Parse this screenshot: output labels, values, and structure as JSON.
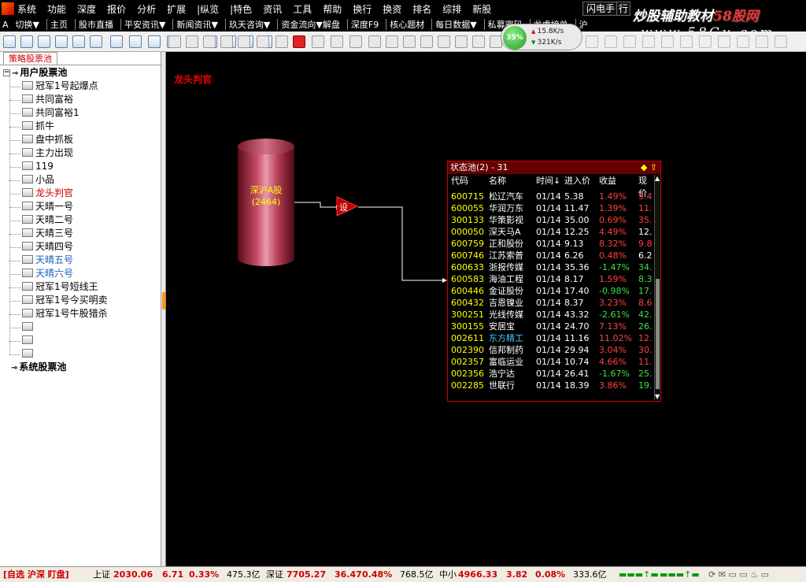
{
  "menubar": {
    "items": [
      "系统",
      "功能",
      "深度",
      "报价",
      "分析",
      "扩展",
      "|纵览",
      "|特色",
      "资讯",
      "工具",
      "帮助",
      "换行",
      "换资",
      "排名",
      "综排",
      "新股"
    ],
    "flash": "闪电手",
    "flash2": "行"
  },
  "watermark": {
    "line1": "炒股辅助教材",
    "line1_red": "58股网",
    "line2": "www.58Gu.com"
  },
  "bar2": {
    "items": [
      "切换▼",
      "主页",
      "股市直播",
      "平安资讯▼",
      "新闻资讯▼",
      "玖天咨询▼",
      "资金流向▼解盘",
      "深度F9",
      "核心题材",
      "每日数据▼",
      "私募密码",
      "龙虎榜单",
      "沪"
    ]
  },
  "netgauge": {
    "percent": "35%",
    "up": "15.8K/s",
    "down": "321K/s"
  },
  "left": {
    "tab": "策略股票池",
    "tree": [
      {
        "label": "用户股票池",
        "kind": "root"
      },
      {
        "label": "冠军1号起爆点",
        "kind": "leaf"
      },
      {
        "label": "共同富裕",
        "kind": "leaf"
      },
      {
        "label": "共同富裕1",
        "kind": "leaf"
      },
      {
        "label": "抓牛",
        "kind": "leaf"
      },
      {
        "label": "盘中抓板",
        "kind": "leaf"
      },
      {
        "label": "主力出现",
        "kind": "leaf"
      },
      {
        "label": "119",
        "kind": "leaf"
      },
      {
        "label": "小品",
        "kind": "leaf"
      },
      {
        "label": "龙头判官",
        "kind": "sel"
      },
      {
        "label": "天晴一号",
        "kind": "leaf"
      },
      {
        "label": "天晴二号",
        "kind": "leaf"
      },
      {
        "label": "天晴三号",
        "kind": "leaf"
      },
      {
        "label": "天晴四号",
        "kind": "leaf"
      },
      {
        "label": "天晴五号",
        "kind": "blue"
      },
      {
        "label": "天晴六号",
        "kind": "blue"
      },
      {
        "label": "冠军1号短线王",
        "kind": "leaf"
      },
      {
        "label": "冠军1号今买明卖",
        "kind": "leaf"
      },
      {
        "label": "冠军1号牛股猎杀",
        "kind": "leaf"
      },
      {
        "label": "",
        "kind": "leaf"
      },
      {
        "label": "",
        "kind": "leaf"
      },
      {
        "label": "",
        "kind": "leaf"
      },
      {
        "label": "系统股票池",
        "kind": "root2"
      }
    ]
  },
  "canvas": {
    "title": "龙头判官",
    "source_label": "深沪A股",
    "source_count": "(2464)",
    "setting_label": "设"
  },
  "pool": {
    "title": "状态池(2) - 31",
    "columns": [
      "代码",
      "名称",
      "时间↓",
      "进入价",
      "收益",
      "现价"
    ],
    "colors": {
      "up": "#ff4040",
      "down": "#40e040",
      "cur_up": "#ff4040",
      "cur_down": "#40e040",
      "highlight": "#40c8ff"
    },
    "rows": [
      {
        "code": "600715",
        "name": "松辽汽车",
        "time": "01/14",
        "price": "5.38",
        "gain": "1.49%",
        "cur": "5.4",
        "dir": "up"
      },
      {
        "code": "600055",
        "name": "华润万东",
        "time": "01/14",
        "price": "11.47",
        "gain": "1.39%",
        "cur": "11.",
        "dir": "up"
      },
      {
        "code": "300133",
        "name": "华策影视",
        "time": "01/14",
        "price": "35.00",
        "gain": "0.69%",
        "cur": "35.",
        "dir": "up"
      },
      {
        "code": "000050",
        "name": "深天马A",
        "time": "01/14",
        "price": "12.25",
        "gain": "4.49%",
        "cur": "12.",
        "dir": "up",
        "cur_white": true
      },
      {
        "code": "600759",
        "name": "正和股份",
        "time": "01/14",
        "price": "9.13",
        "gain": "8.32%",
        "cur": "9.8",
        "dir": "up"
      },
      {
        "code": "600746",
        "name": "江苏索普",
        "time": "01/14",
        "price": "6.26",
        "gain": "0.48%",
        "cur": "6.2",
        "dir": "up",
        "cur_white": true
      },
      {
        "code": "600633",
        "name": "浙报传媒",
        "time": "01/14",
        "price": "35.36",
        "gain": "-1.47%",
        "cur": "34.",
        "dir": "down"
      },
      {
        "code": "600583",
        "name": "海油工程",
        "time": "01/14",
        "price": "8.17",
        "gain": "1.59%",
        "cur": "8.3",
        "dir": "up",
        "cur_green": true
      },
      {
        "code": "600446",
        "name": "金证股份",
        "time": "01/14",
        "price": "17.40",
        "gain": "-0.98%",
        "cur": "17.",
        "dir": "down"
      },
      {
        "code": "600432",
        "name": "吉恩镍业",
        "time": "01/14",
        "price": "8.37",
        "gain": "3.23%",
        "cur": "8.6",
        "dir": "up"
      },
      {
        "code": "300251",
        "name": "光线传媒",
        "time": "01/14",
        "price": "43.32",
        "gain": "-2.61%",
        "cur": "42.",
        "dir": "down"
      },
      {
        "code": "300155",
        "name": "安居宝",
        "time": "01/14",
        "price": "24.70",
        "gain": "7.13%",
        "cur": "26.",
        "dir": "up",
        "cur_green": true
      },
      {
        "code": "002611",
        "name": "东方精工",
        "time": "01/14",
        "price": "11.16",
        "gain": "11.02%",
        "cur": "12.",
        "dir": "up",
        "name_hl": true
      },
      {
        "code": "002390",
        "name": "信邦制药",
        "time": "01/14",
        "price": "29.94",
        "gain": "3.04%",
        "cur": "30.",
        "dir": "up"
      },
      {
        "code": "002357",
        "name": "富临运业",
        "time": "01/14",
        "price": "10.74",
        "gain": "4.66%",
        "cur": "11.",
        "dir": "up"
      },
      {
        "code": "002356",
        "name": "浩宁达",
        "time": "01/14",
        "price": "26.41",
        "gain": "-1.67%",
        "cur": "25.",
        "dir": "down"
      },
      {
        "code": "002285",
        "name": "世联行",
        "time": "01/14",
        "price": "18.39",
        "gain": "3.86%",
        "cur": "19.",
        "dir": "up",
        "cur_green": true
      }
    ]
  },
  "statusbar": {
    "prefix": "[自选 沪深 盯盘]",
    "sh_label": "上证",
    "sh_index": "2030.06",
    "sh_chg": "6.71",
    "sh_pct": "0.33%",
    "sh_amt": "475.3亿",
    "sz_label": "深证",
    "sz_index": "7705.27",
    "sz_chg": "36.47",
    "sz_pct": "0.48%",
    "sz_amt": "768.5亿",
    "zx_label": "中小",
    "zx_index": "4966.33",
    "zx_chg": "3.82",
    "zx_pct": "0.08%",
    "zx_amt": "333.6亿"
  }
}
